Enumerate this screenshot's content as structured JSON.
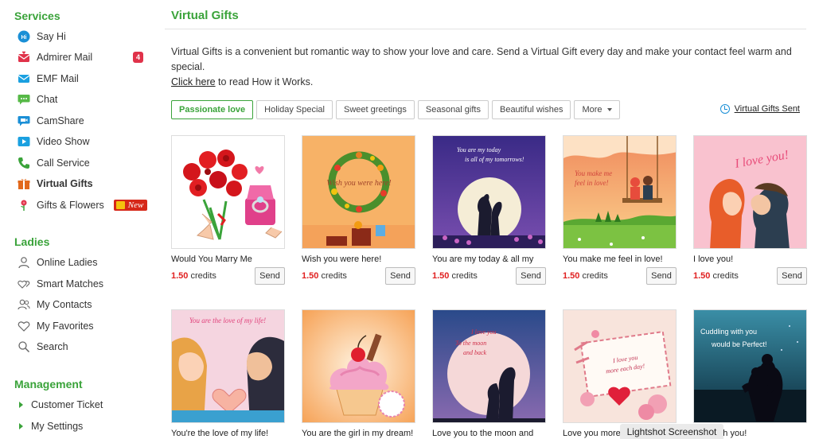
{
  "sidebar": {
    "services_title": "Services",
    "services": [
      {
        "label": "Say Hi",
        "icon": "say-hi-icon",
        "color": "#1a8fd6"
      },
      {
        "label": "Admirer Mail",
        "icon": "admirer-mail-icon",
        "color": "#e0324a",
        "badge": "4"
      },
      {
        "label": "EMF Mail",
        "icon": "emf-mail-icon",
        "color": "#1aa0e0"
      },
      {
        "label": "Chat",
        "icon": "chat-icon",
        "color": "#56b947"
      },
      {
        "label": "CamShare",
        "icon": "camshare-icon",
        "color": "#1a8fd6"
      },
      {
        "label": "Video Show",
        "icon": "video-show-icon",
        "color": "#1aa0e0"
      },
      {
        "label": "Call Service",
        "icon": "call-service-icon",
        "color": "#3aa33a"
      },
      {
        "label": "Virtual Gifts",
        "icon": "virtual-gifts-icon",
        "color": "#e2681b",
        "active": true
      },
      {
        "label": "Gifts & Flowers",
        "icon": "gifts-flowers-icon",
        "color": "#e0324a",
        "new_badge": "New"
      }
    ],
    "ladies_title": "Ladies",
    "ladies": [
      {
        "label": "Online Ladies",
        "icon": "person-icon"
      },
      {
        "label": "Smart Matches",
        "icon": "hearts-icon"
      },
      {
        "label": "My Contacts",
        "icon": "contacts-icon"
      },
      {
        "label": "My Favorites",
        "icon": "heart-icon"
      },
      {
        "label": "Search",
        "icon": "search-icon"
      }
    ],
    "management_title": "Management",
    "management": [
      {
        "label": "Customer Ticket"
      },
      {
        "label": "My Settings"
      }
    ]
  },
  "main": {
    "title": "Virtual Gifts",
    "intro_text": "Virtual Gifts is a convenient but romantic way to show your love and care. Send a Virtual Gift every day and make your contact feel warm and special.",
    "intro_link": "Click here",
    "intro_tail": " to read How it Works.",
    "tabs": [
      "Passionate love",
      "Holiday Special",
      "Sweet greetings",
      "Seasonal gifts",
      "Beautiful wishes",
      "More"
    ],
    "sent_link": "Virtual Gifts Sent",
    "credits_label": "credits",
    "send_label": "Send",
    "gifts": [
      {
        "name": "Would You Marry Me",
        "price": "1.50",
        "theme": "roses-ring"
      },
      {
        "name": "Wish you were here!",
        "price": "1.50",
        "theme": "wreath",
        "caption": "Wish you were here!"
      },
      {
        "name": "You are my today & all my",
        "price": "1.50",
        "theme": "moon-couple",
        "caption": "You are my today is all of my tomorrows!"
      },
      {
        "name": "You make me feel in love!",
        "price": "1.50",
        "theme": "swing",
        "caption": "You make me feel in love!"
      },
      {
        "name": "I love you!",
        "price": "1.50",
        "theme": "kiss",
        "caption": "I love you!"
      },
      {
        "name": "You're the love of my life!",
        "price": "",
        "theme": "heart-hands",
        "caption": "You are the love of my life!"
      },
      {
        "name": "You are the girl in my dream!",
        "price": "",
        "theme": "cupcake"
      },
      {
        "name": "Love you to the moon and",
        "price": "",
        "theme": "moon-night",
        "caption": "I love you To the moon and back"
      },
      {
        "name": "Love you more e",
        "price": "",
        "theme": "letter",
        "caption": "I love you more each day!"
      },
      {
        "name": "ddle with you!",
        "price": "",
        "theme": "lake",
        "caption": "Cuddling with you would be Perfect!"
      }
    ]
  },
  "overlay": {
    "toast": "Lightshot Screenshot"
  }
}
